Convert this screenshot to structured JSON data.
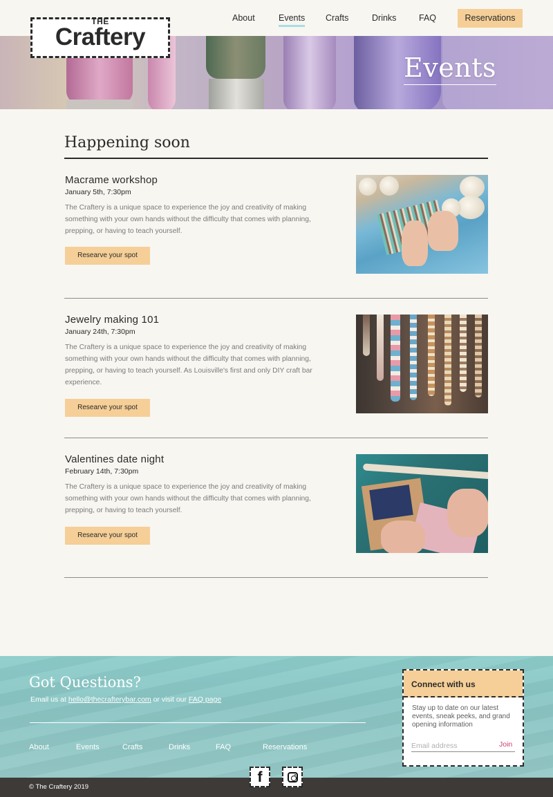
{
  "brand": {
    "the": "THE",
    "name": "Craftery"
  },
  "nav": {
    "items": [
      "About",
      "Events",
      "Crafts",
      "Drinks",
      "FAQ"
    ],
    "active": "Events",
    "reservations": "Reservations"
  },
  "hero": {
    "title": "Events"
  },
  "main": {
    "section_title": "Happening soon",
    "events": [
      {
        "title": "Macrame workshop",
        "date": "January 5th, 7:30pm",
        "description": "The Craftery is a unique space to experience the joy and creativity of making something with your own hands without the difficulty that comes with planning, prepping, or having to teach yourself.",
        "button": "Researve your spot"
      },
      {
        "title": "Jewelry making 101",
        "date": "January 24th, 7:30pm",
        "description": "The Craftery is a unique space to experience the joy and creativity of making something with your own hands without the difficulty that comes with planning, prepping, or having to teach yourself. As Louisville's first and only DIY craft bar experience.",
        "button": "Researve your spot"
      },
      {
        "title": "Valentines date night",
        "date": "February 14th, 7:30pm",
        "description": "The Craftery is a unique space to experience the joy and creativity of making something with your own hands without the difficulty that comes with planning, prepping, or having to teach yourself.",
        "button": "Researve your spot"
      }
    ]
  },
  "footer": {
    "title": "Got Questions?",
    "email_prefix": "Email us at ",
    "email": "hello@thecrafterybar.com",
    "email_mid": " or visit our ",
    "faq_link": "FAQ page",
    "nav": [
      "About",
      "Events",
      "Crafts",
      "Drinks",
      "FAQ",
      "Reservations"
    ],
    "copyright": "© The Craftery 2019",
    "social": [
      "facebook-icon",
      "instagram-icon"
    ]
  },
  "connect": {
    "heading": "Connect with us",
    "text": "Stay up to date on our latest events, sneak peeks, and grand opening information",
    "email_placeholder": "Email address",
    "email_value": "",
    "join": "Join"
  },
  "colors": {
    "accent": "#f5cf97",
    "teal": "#8ccdcb",
    "nav_underline": "#a9dde1",
    "join": "#d13c68",
    "dark": "#2a2a2a"
  }
}
